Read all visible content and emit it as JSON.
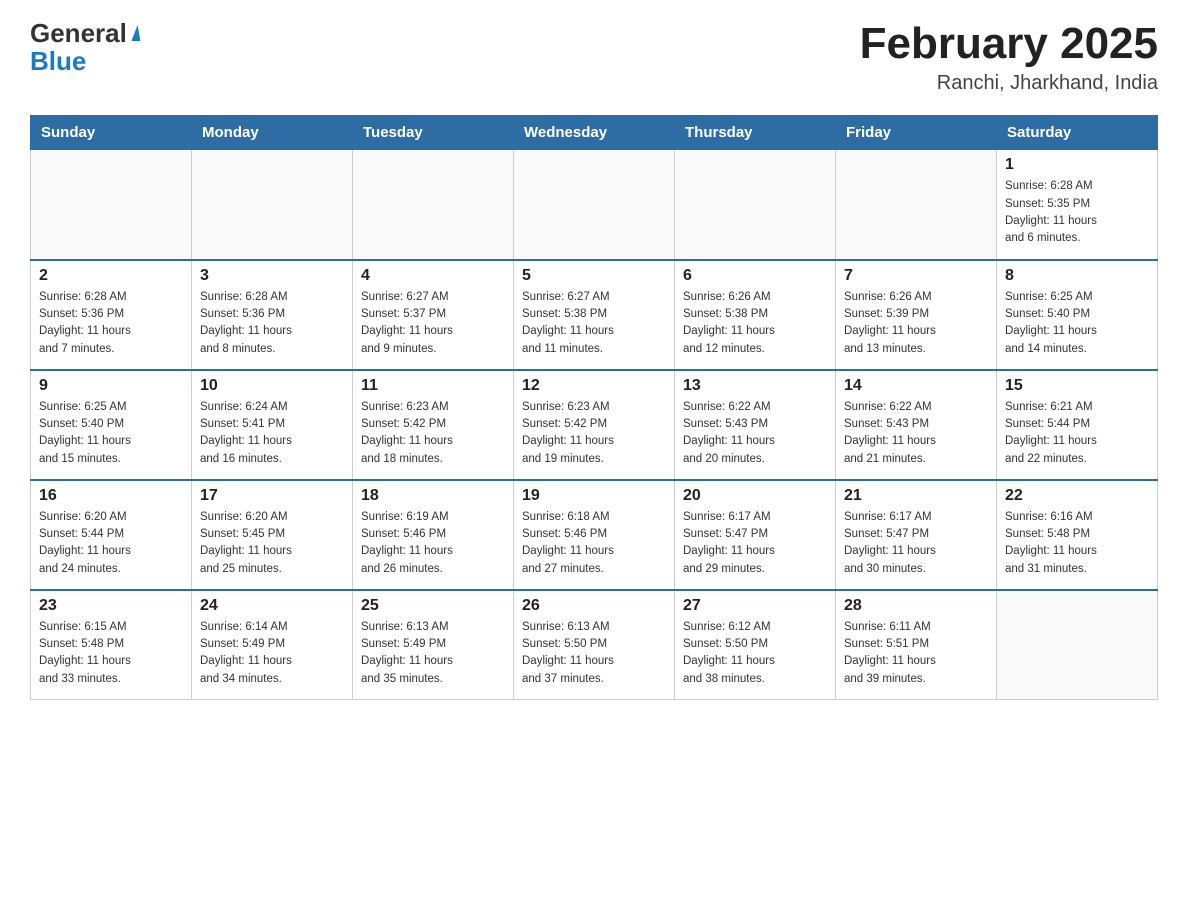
{
  "header": {
    "logo_general": "General",
    "logo_blue": "Blue",
    "month_year": "February 2025",
    "location": "Ranchi, Jharkhand, India"
  },
  "days_of_week": [
    "Sunday",
    "Monday",
    "Tuesday",
    "Wednesday",
    "Thursday",
    "Friday",
    "Saturday"
  ],
  "weeks": [
    [
      {
        "day": "",
        "info": ""
      },
      {
        "day": "",
        "info": ""
      },
      {
        "day": "",
        "info": ""
      },
      {
        "day": "",
        "info": ""
      },
      {
        "day": "",
        "info": ""
      },
      {
        "day": "",
        "info": ""
      },
      {
        "day": "1",
        "info": "Sunrise: 6:28 AM\nSunset: 5:35 PM\nDaylight: 11 hours\nand 6 minutes."
      }
    ],
    [
      {
        "day": "2",
        "info": "Sunrise: 6:28 AM\nSunset: 5:36 PM\nDaylight: 11 hours\nand 7 minutes."
      },
      {
        "day": "3",
        "info": "Sunrise: 6:28 AM\nSunset: 5:36 PM\nDaylight: 11 hours\nand 8 minutes."
      },
      {
        "day": "4",
        "info": "Sunrise: 6:27 AM\nSunset: 5:37 PM\nDaylight: 11 hours\nand 9 minutes."
      },
      {
        "day": "5",
        "info": "Sunrise: 6:27 AM\nSunset: 5:38 PM\nDaylight: 11 hours\nand 11 minutes."
      },
      {
        "day": "6",
        "info": "Sunrise: 6:26 AM\nSunset: 5:38 PM\nDaylight: 11 hours\nand 12 minutes."
      },
      {
        "day": "7",
        "info": "Sunrise: 6:26 AM\nSunset: 5:39 PM\nDaylight: 11 hours\nand 13 minutes."
      },
      {
        "day": "8",
        "info": "Sunrise: 6:25 AM\nSunset: 5:40 PM\nDaylight: 11 hours\nand 14 minutes."
      }
    ],
    [
      {
        "day": "9",
        "info": "Sunrise: 6:25 AM\nSunset: 5:40 PM\nDaylight: 11 hours\nand 15 minutes."
      },
      {
        "day": "10",
        "info": "Sunrise: 6:24 AM\nSunset: 5:41 PM\nDaylight: 11 hours\nand 16 minutes."
      },
      {
        "day": "11",
        "info": "Sunrise: 6:23 AM\nSunset: 5:42 PM\nDaylight: 11 hours\nand 18 minutes."
      },
      {
        "day": "12",
        "info": "Sunrise: 6:23 AM\nSunset: 5:42 PM\nDaylight: 11 hours\nand 19 minutes."
      },
      {
        "day": "13",
        "info": "Sunrise: 6:22 AM\nSunset: 5:43 PM\nDaylight: 11 hours\nand 20 minutes."
      },
      {
        "day": "14",
        "info": "Sunrise: 6:22 AM\nSunset: 5:43 PM\nDaylight: 11 hours\nand 21 minutes."
      },
      {
        "day": "15",
        "info": "Sunrise: 6:21 AM\nSunset: 5:44 PM\nDaylight: 11 hours\nand 22 minutes."
      }
    ],
    [
      {
        "day": "16",
        "info": "Sunrise: 6:20 AM\nSunset: 5:44 PM\nDaylight: 11 hours\nand 24 minutes."
      },
      {
        "day": "17",
        "info": "Sunrise: 6:20 AM\nSunset: 5:45 PM\nDaylight: 11 hours\nand 25 minutes."
      },
      {
        "day": "18",
        "info": "Sunrise: 6:19 AM\nSunset: 5:46 PM\nDaylight: 11 hours\nand 26 minutes."
      },
      {
        "day": "19",
        "info": "Sunrise: 6:18 AM\nSunset: 5:46 PM\nDaylight: 11 hours\nand 27 minutes."
      },
      {
        "day": "20",
        "info": "Sunrise: 6:17 AM\nSunset: 5:47 PM\nDaylight: 11 hours\nand 29 minutes."
      },
      {
        "day": "21",
        "info": "Sunrise: 6:17 AM\nSunset: 5:47 PM\nDaylight: 11 hours\nand 30 minutes."
      },
      {
        "day": "22",
        "info": "Sunrise: 6:16 AM\nSunset: 5:48 PM\nDaylight: 11 hours\nand 31 minutes."
      }
    ],
    [
      {
        "day": "23",
        "info": "Sunrise: 6:15 AM\nSunset: 5:48 PM\nDaylight: 11 hours\nand 33 minutes."
      },
      {
        "day": "24",
        "info": "Sunrise: 6:14 AM\nSunset: 5:49 PM\nDaylight: 11 hours\nand 34 minutes."
      },
      {
        "day": "25",
        "info": "Sunrise: 6:13 AM\nSunset: 5:49 PM\nDaylight: 11 hours\nand 35 minutes."
      },
      {
        "day": "26",
        "info": "Sunrise: 6:13 AM\nSunset: 5:50 PM\nDaylight: 11 hours\nand 37 minutes."
      },
      {
        "day": "27",
        "info": "Sunrise: 6:12 AM\nSunset: 5:50 PM\nDaylight: 11 hours\nand 38 minutes."
      },
      {
        "day": "28",
        "info": "Sunrise: 6:11 AM\nSunset: 5:51 PM\nDaylight: 11 hours\nand 39 minutes."
      },
      {
        "day": "",
        "info": ""
      }
    ]
  ]
}
